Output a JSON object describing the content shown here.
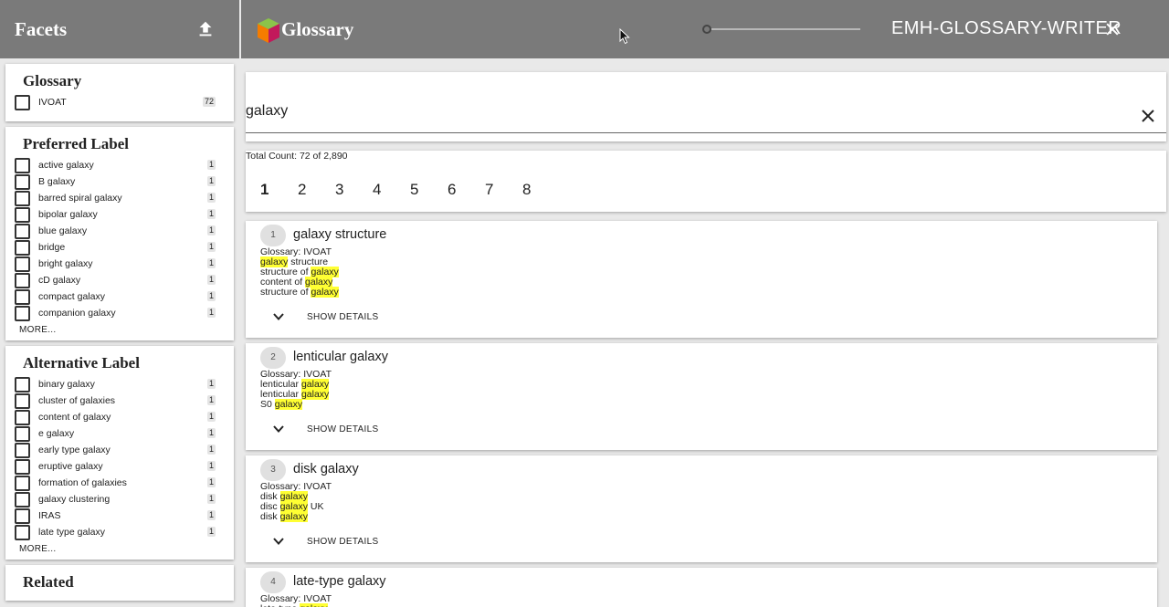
{
  "sidebar": {
    "title": "Facets",
    "more_label": "MORE...",
    "facets": [
      {
        "title": "Glossary",
        "items": [
          {
            "label": "IVOAT",
            "count": "72"
          }
        ]
      },
      {
        "title": "Preferred Label",
        "items": [
          {
            "label": "active galaxy",
            "count": "1"
          },
          {
            "label": "B galaxy",
            "count": "1"
          },
          {
            "label": "barred spiral galaxy",
            "count": "1"
          },
          {
            "label": "bipolar galaxy",
            "count": "1"
          },
          {
            "label": "blue galaxy",
            "count": "1"
          },
          {
            "label": "bridge",
            "count": "1"
          },
          {
            "label": "bright galaxy",
            "count": "1"
          },
          {
            "label": "cD galaxy",
            "count": "1"
          },
          {
            "label": "compact galaxy",
            "count": "1"
          },
          {
            "label": "companion galaxy",
            "count": "1"
          }
        ]
      },
      {
        "title": "Alternative Label",
        "items": [
          {
            "label": "binary galaxy",
            "count": "1"
          },
          {
            "label": "cluster of galaxies",
            "count": "1"
          },
          {
            "label": "content of galaxy",
            "count": "1"
          },
          {
            "label": "e galaxy",
            "count": "1"
          },
          {
            "label": "early type galaxy",
            "count": "1"
          },
          {
            "label": "eruptive galaxy",
            "count": "1"
          },
          {
            "label": "formation of galaxies",
            "count": "1"
          },
          {
            "label": "galaxy clustering",
            "count": "1"
          },
          {
            "label": "IRAS",
            "count": "1"
          },
          {
            "label": "late type galaxy",
            "count": "1"
          }
        ]
      },
      {
        "title": "Related",
        "items": []
      }
    ]
  },
  "header": {
    "app_title": "Glossary",
    "user": "EMH-GLOSSARY-WRITER",
    "slider_value": 0,
    "colors": {
      "bar": "#7a7a7a",
      "highlight": "#ffff33"
    }
  },
  "search": {
    "value": "galaxy"
  },
  "results": {
    "total_count": "Total Count: 72 of 2,890",
    "pages": [
      "1",
      "2",
      "3",
      "4",
      "5",
      "6",
      "7",
      "8"
    ],
    "active_page": "1",
    "show_details_label": "SHOW DETAILS",
    "items": [
      {
        "num": "1",
        "title": "galaxy structure",
        "lines": [
          [
            {
              "t": "Glossary: IVOAT",
              "h": false
            }
          ],
          [
            {
              "t": "galaxy",
              "h": true
            },
            {
              "t": " structure",
              "h": false
            }
          ],
          [
            {
              "t": "structure of ",
              "h": false
            },
            {
              "t": "galaxy",
              "h": true
            }
          ],
          [
            {
              "t": "content of ",
              "h": false
            },
            {
              "t": "galaxy",
              "h": true
            }
          ],
          [
            {
              "t": "structure of ",
              "h": false
            },
            {
              "t": "galaxy",
              "h": true
            }
          ]
        ]
      },
      {
        "num": "2",
        "title": "lenticular galaxy",
        "lines": [
          [
            {
              "t": "Glossary: IVOAT",
              "h": false
            }
          ],
          [
            {
              "t": "lenticular ",
              "h": false
            },
            {
              "t": "galaxy",
              "h": true
            }
          ],
          [
            {
              "t": "lenticular ",
              "h": false
            },
            {
              "t": "galaxy",
              "h": true
            }
          ],
          [
            {
              "t": "S0 ",
              "h": false
            },
            {
              "t": "galaxy",
              "h": true
            }
          ]
        ]
      },
      {
        "num": "3",
        "title": "disk galaxy",
        "lines": [
          [
            {
              "t": "Glossary: IVOAT",
              "h": false
            }
          ],
          [
            {
              "t": "disk ",
              "h": false
            },
            {
              "t": "galaxy",
              "h": true
            }
          ],
          [
            {
              "t": "disc ",
              "h": false
            },
            {
              "t": "galaxy",
              "h": true
            },
            {
              "t": " UK",
              "h": false
            }
          ],
          [
            {
              "t": "disk ",
              "h": false
            },
            {
              "t": "galaxy",
              "h": true
            }
          ]
        ]
      },
      {
        "num": "4",
        "title": "late-type galaxy",
        "lines": [
          [
            {
              "t": "Glossary: IVOAT",
              "h": false
            }
          ],
          [
            {
              "t": "late-type ",
              "h": false
            },
            {
              "t": "galaxy",
              "h": true
            }
          ]
        ]
      }
    ]
  }
}
